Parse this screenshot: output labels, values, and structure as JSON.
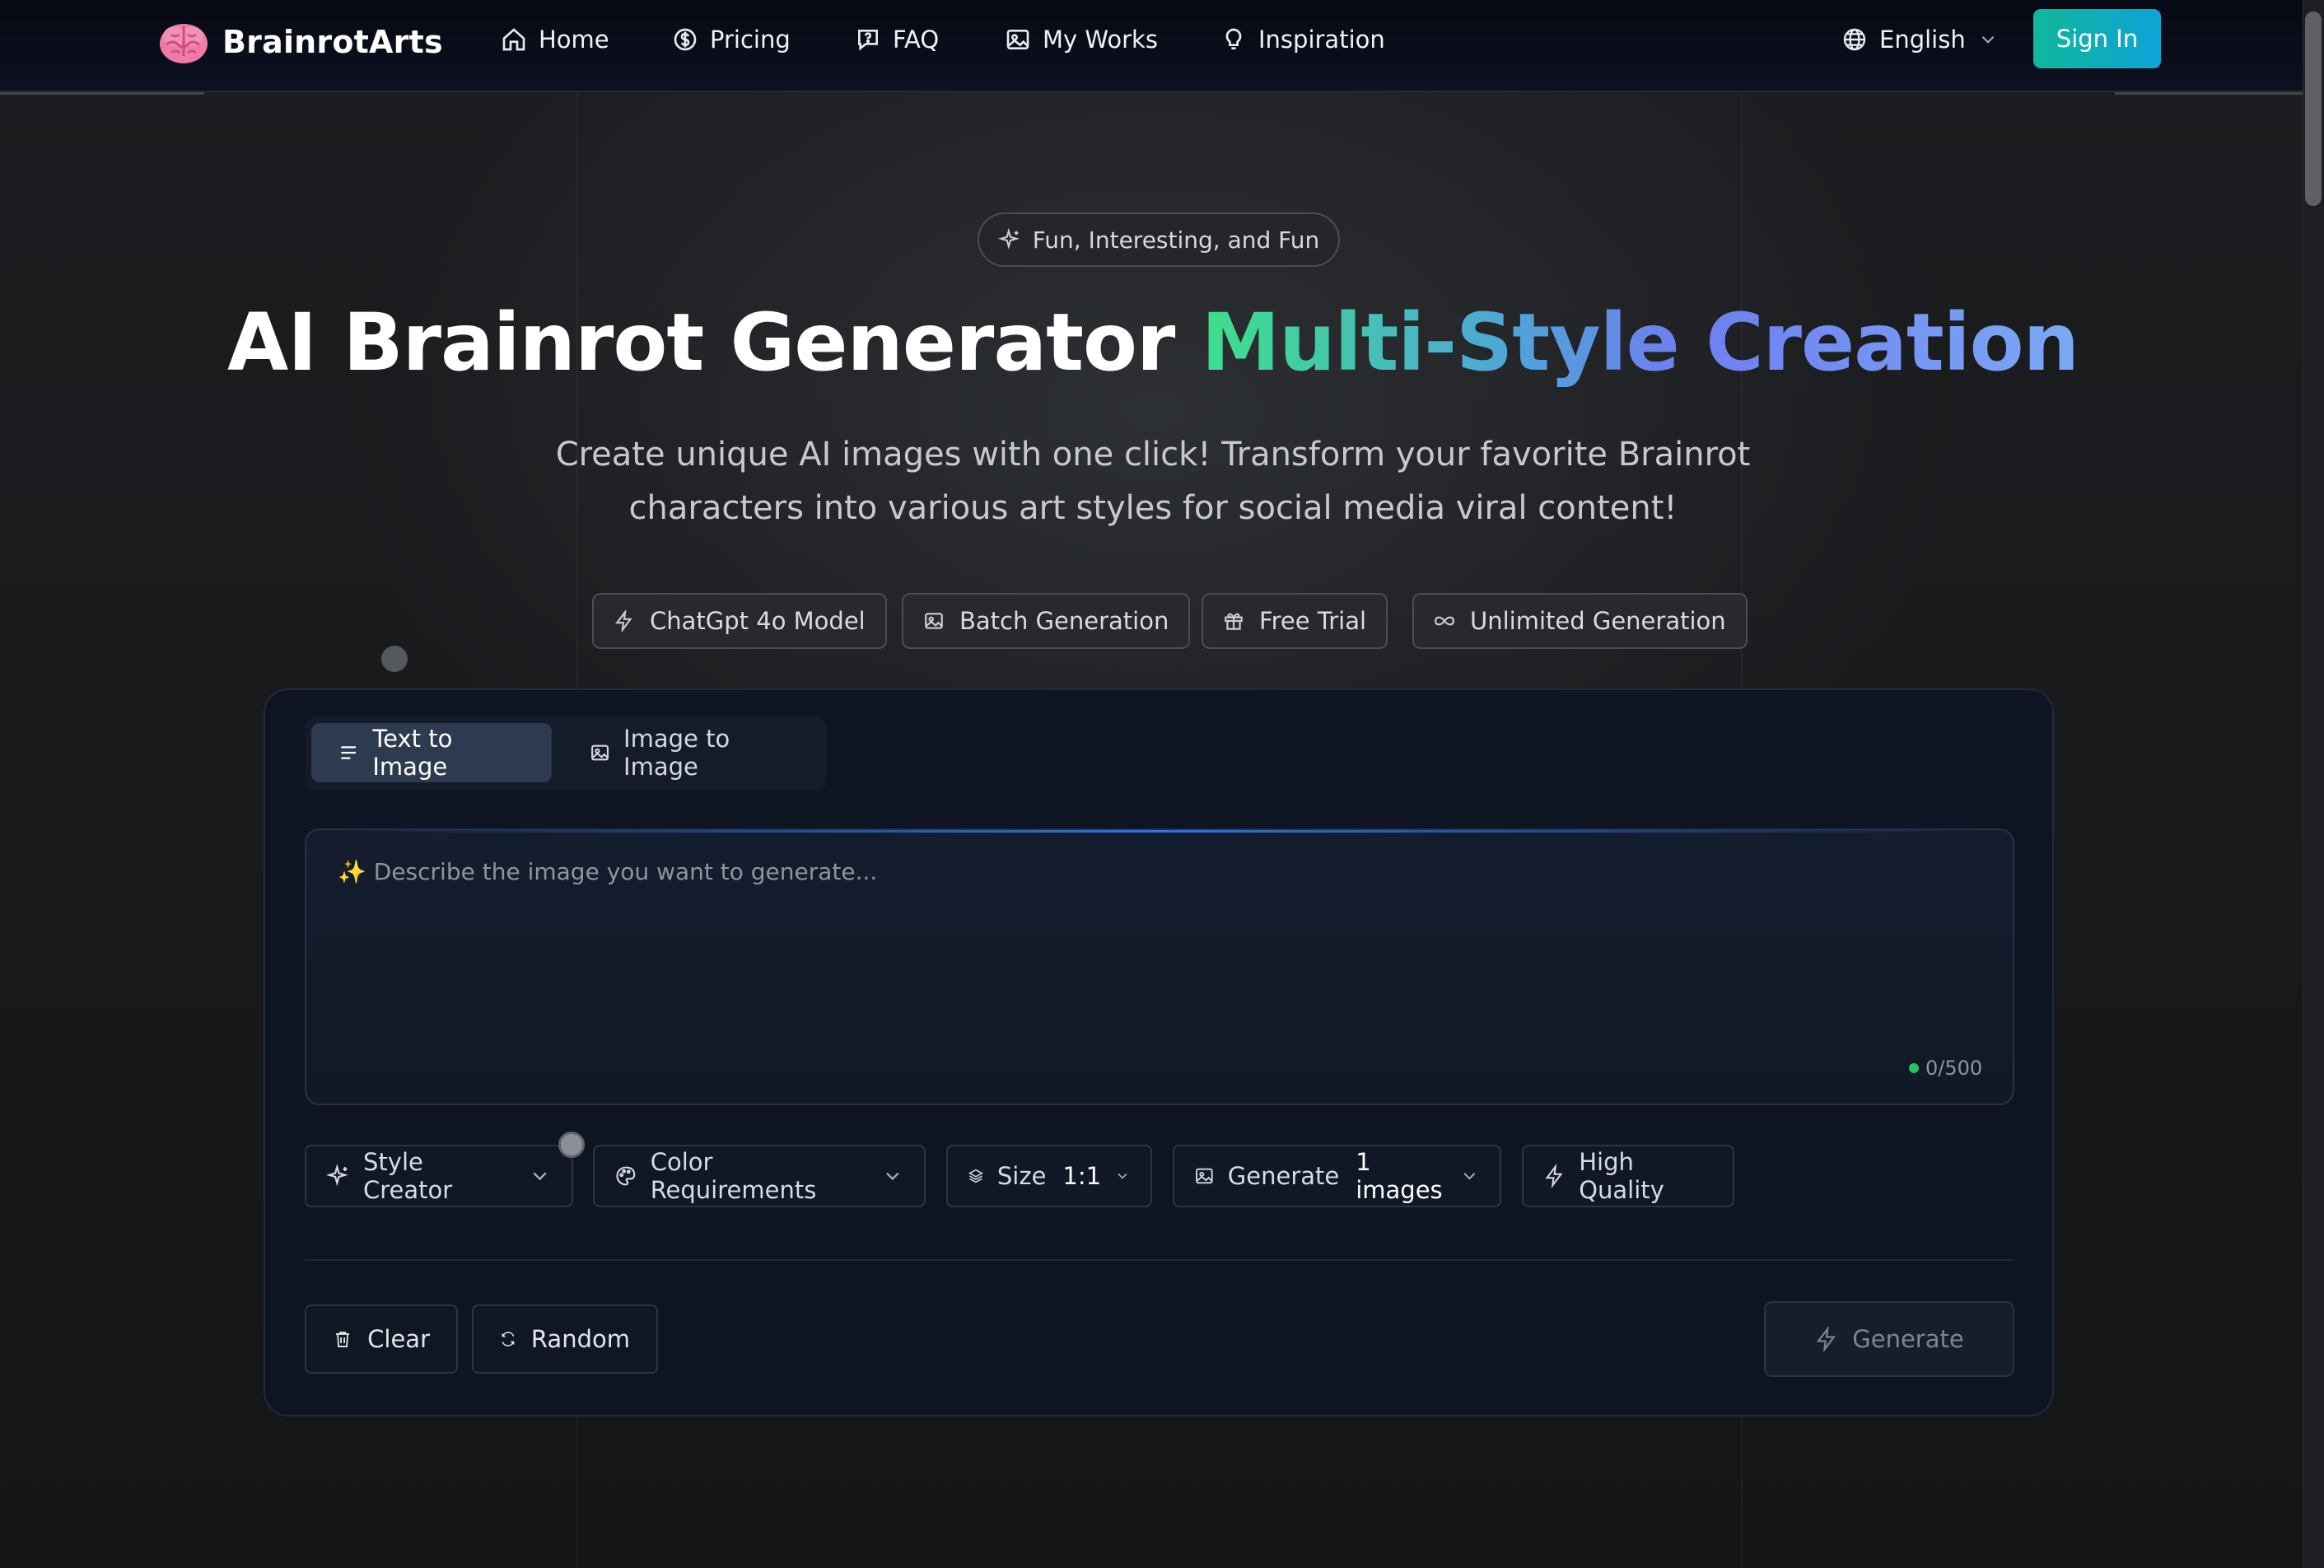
{
  "brand": {
    "name": "BrainrotArts",
    "logo_icon": "brain-icon"
  },
  "nav": {
    "items": [
      {
        "label": "Home",
        "icon": "home-icon"
      },
      {
        "label": "Pricing",
        "icon": "dollar-circle-icon"
      },
      {
        "label": "FAQ",
        "icon": "chat-question-icon"
      },
      {
        "label": "My Works",
        "icon": "image-icon"
      },
      {
        "label": "Inspiration",
        "icon": "lightbulb-icon"
      }
    ],
    "language": "English",
    "sign_in": "Sign In"
  },
  "hero": {
    "badge": "Fun, Interesting, and Fun",
    "title_main": "AI Brainrot Generator",
    "title_highlight": "Multi-Style Creation",
    "subtitle": "Create unique AI images with one click! Transform your favorite Brainrot characters into various art styles for social media viral content!",
    "features": [
      {
        "label": "ChatGpt 4o Model",
        "icon": "lightning-icon"
      },
      {
        "label": "Batch Generation",
        "icon": "image-icon"
      },
      {
        "label": "Free Trial",
        "icon": "gift-icon"
      },
      {
        "label": "Unlimited Generation",
        "icon": "infinity-icon"
      }
    ]
  },
  "generator": {
    "tabs": [
      {
        "label": "Text to Image",
        "active": true
      },
      {
        "label": "Image to Image",
        "active": false
      }
    ],
    "prompt": {
      "value": "",
      "placeholder": "✨ Describe the image you want to generate...",
      "counter": "0/500"
    },
    "options": {
      "style": "Style Creator",
      "color": "Color Requirements",
      "size_label": "Size",
      "size_value": "1:1",
      "count_label": "Generate",
      "count_value": "1 images",
      "quality": "High Quality"
    },
    "actions": {
      "clear": "Clear",
      "random": "Random",
      "generate": "Generate"
    }
  },
  "colors": {
    "accent_teal": "#0fb89a",
    "accent_blue": "#0fa2d8",
    "title_gradient_start": "#3ee08a",
    "title_gradient_end": "#7aa9f4",
    "counter_dot": "#22c55e"
  }
}
